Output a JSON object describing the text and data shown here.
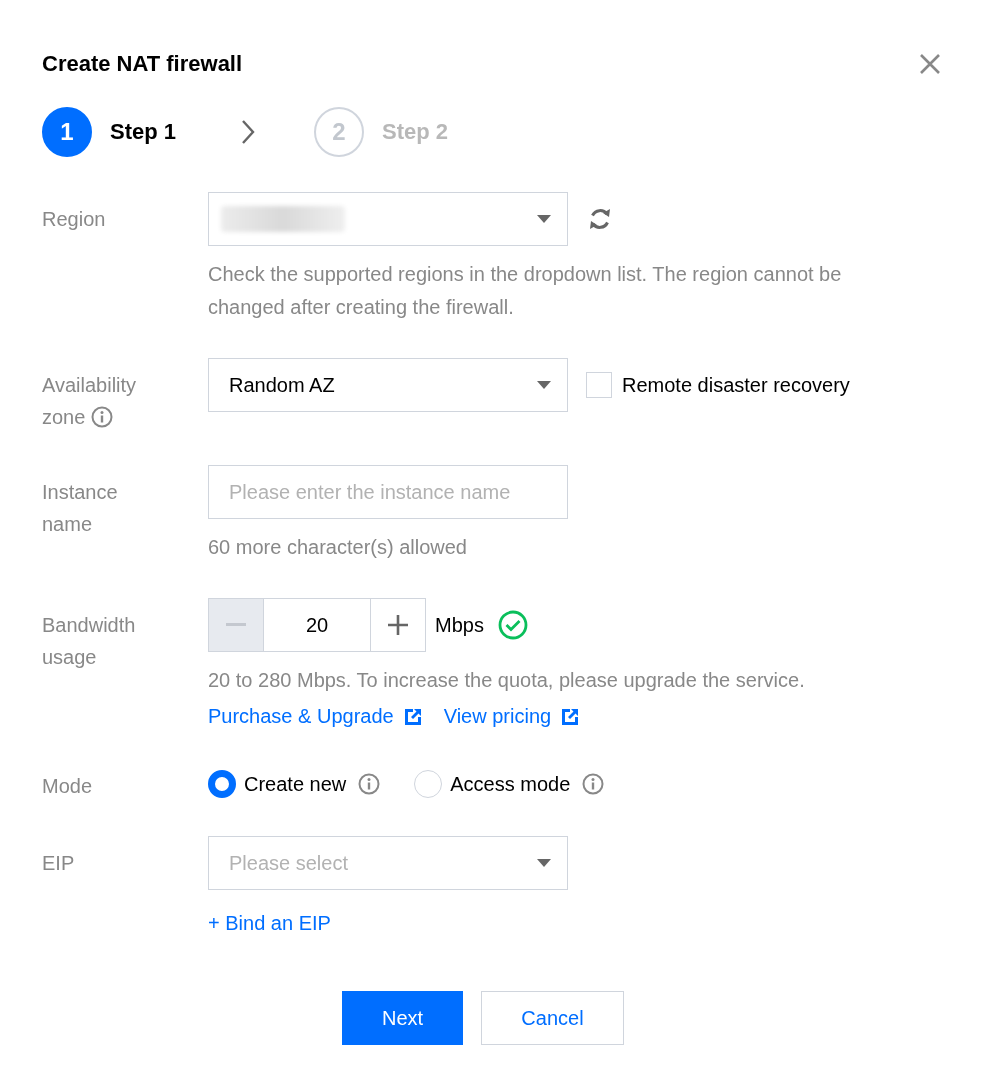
{
  "dialog": {
    "title": "Create NAT firewall"
  },
  "steps": [
    {
      "number": "1",
      "label": "Step 1",
      "selected": true
    },
    {
      "number": "2",
      "label": "Step 2",
      "selected": false
    }
  ],
  "region": {
    "label": "Region",
    "hint": "Check the supported regions in the dropdown list. The region cannot be changed after creating the firewall."
  },
  "availability_zone": {
    "label": "Availability zone",
    "value": "Random AZ",
    "remote_disaster_recovery": {
      "label": "Remote disaster recovery",
      "checked": false
    }
  },
  "instance_name": {
    "label": "Instance name",
    "placeholder": "Please enter the instance name",
    "hint": "60 more character(s) allowed"
  },
  "bandwidth": {
    "label": "Bandwidth usage",
    "value": "20",
    "unit": "Mbps",
    "decrease_disabled": true,
    "valid": true,
    "hint": "20 to 280 Mbps. To increase the quota, please upgrade the service.",
    "links": [
      "Purchase & Upgrade",
      "View pricing"
    ]
  },
  "mode": {
    "label": "Mode",
    "options": [
      {
        "label": "Create new",
        "selected": true
      },
      {
        "label": "Access mode",
        "selected": false
      }
    ]
  },
  "eip": {
    "label": "EIP",
    "placeholder": "Please select",
    "link": "+ Bind an EIP"
  },
  "buttons": [
    {
      "label": "Next",
      "kind": "primary"
    },
    {
      "label": "Cancel",
      "kind": "secondary"
    }
  ]
}
